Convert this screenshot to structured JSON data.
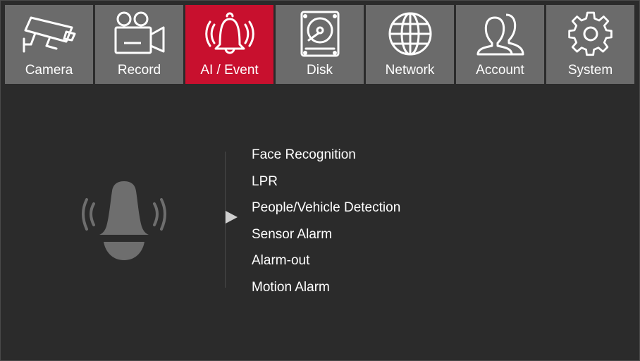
{
  "tabs": [
    {
      "label": "Camera",
      "icon": "cctv-camera-icon",
      "active": false
    },
    {
      "label": "Record",
      "icon": "video-camera-icon",
      "active": false
    },
    {
      "label": "AI / Event",
      "icon": "alarm-bell-icon",
      "active": true
    },
    {
      "label": "Disk",
      "icon": "hard-disk-icon",
      "active": false
    },
    {
      "label": "Network",
      "icon": "globe-icon",
      "active": false
    },
    {
      "label": "Account",
      "icon": "users-icon",
      "active": false
    },
    {
      "label": "System",
      "icon": "gear-icon",
      "active": false
    }
  ],
  "colors": {
    "tab_bg": "#6b6b6b",
    "tab_active_bg": "#c8102e",
    "panel_bg": "#2b2b2b",
    "icon_gray": "#6e6e6e"
  },
  "panel": {
    "icon": "alarm-bell-icon",
    "menu": [
      "Face Recognition",
      "LPR",
      "People/Vehicle Detection",
      "Sensor Alarm",
      "Alarm-out",
      "Motion Alarm"
    ]
  }
}
